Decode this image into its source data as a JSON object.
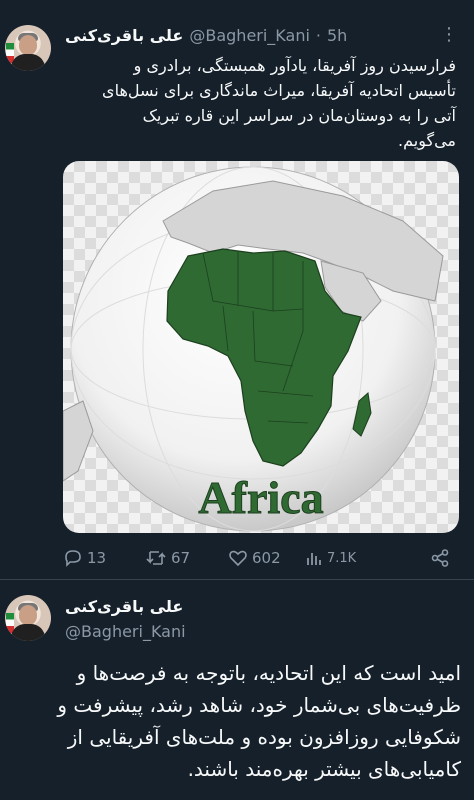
{
  "tweet1": {
    "name": "علی باقری‌کنی",
    "handle": "@Bagheri_Kani",
    "dot": "·",
    "time": "5h",
    "more": "⋮",
    "text_lines": [
      "فرارسیدن روز آفریقا، یادآور همبستگی، برادری و",
      "تأسیس اتحادیه آفریقا، میراث ماندگاری برای نسل‌های",
      "آتی را به دوستان‌مان در سراسر این قاره تبریک",
      "می‌گویم."
    ],
    "image_caption": "Africa",
    "actions": {
      "replies": "13",
      "retweets": "67",
      "likes": "602",
      "views": "7.1K"
    }
  },
  "tweet2": {
    "name": "علی باقری‌کنی",
    "handle": "@Bagheri_Kani",
    "text_lines": [
      "امید است که این اتحادیه، باتوجه به فرصت‌ها و",
      "ظرفیت‌های بی‌شمار خود، شاهد رشد، پیشرفت و",
      "شکوفایی روزافزون بوده و ملت‌های آفریقایی از",
      "کامیابی‌های بیشتر بهره‌مند باشند."
    ]
  },
  "colors": {
    "background": "#15202b",
    "text": "#f7f9f9",
    "secondary": "#8b98a5",
    "divider": "#38444d",
    "map_green": "#2f6a32"
  },
  "icons": [
    "reply-icon",
    "retweet-icon",
    "like-icon",
    "views-icon",
    "share-icon",
    "more-icon"
  ]
}
